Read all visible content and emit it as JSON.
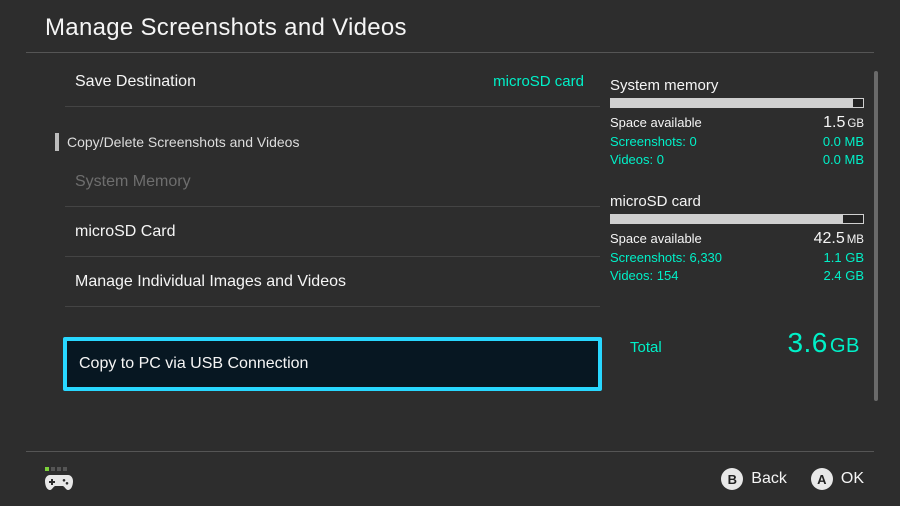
{
  "title": "Manage Screenshots and Videos",
  "left": {
    "save_destination_label": "Save Destination",
    "save_destination_value": "microSD card",
    "section_label": "Copy/Delete Screenshots and Videos",
    "item_system_memory": "System Memory",
    "item_microsd": "microSD Card",
    "item_manage": "Manage Individual Images and Videos",
    "item_copy_usb": "Copy to PC via USB Connection"
  },
  "right": {
    "system": {
      "title": "System memory",
      "space_label": "Space available",
      "space_value": "1.5",
      "space_unit": "GB",
      "bar_remaining_pct": 4,
      "screenshots_label": "Screenshots: 0",
      "screenshots_value": "0.0 MB",
      "videos_label": "Videos: 0",
      "videos_value": "0.0 MB"
    },
    "sd": {
      "title": "microSD card",
      "space_label": "Space available",
      "space_value": "42.5",
      "space_unit": "MB",
      "bar_remaining_pct": 8,
      "screenshots_label": "Screenshots: 6,330",
      "screenshots_value": "1.1 GB",
      "videos_label": "Videos: 154",
      "videos_value": "2.4 GB"
    },
    "total_label": "Total",
    "total_value": "3.6",
    "total_unit": "GB"
  },
  "footer": {
    "back_label": "Back",
    "ok_label": "OK",
    "back_glyph": "B",
    "ok_glyph": "A"
  }
}
